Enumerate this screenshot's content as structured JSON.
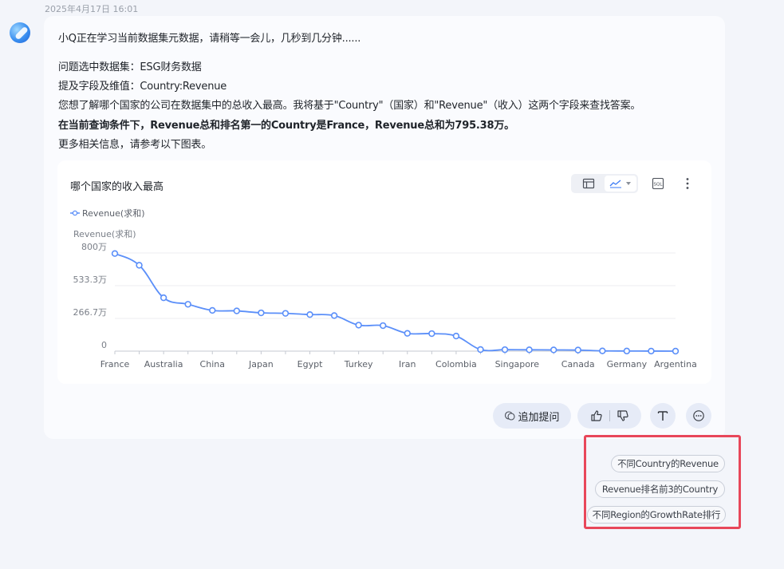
{
  "timestamp": "2025年4月17日 16:01",
  "message": {
    "loading": "小Q正在学习当前数据集元数据，请稍等一会儿，几秒到几分钟......",
    "dataset": "问题选中数据集：ESG财务数据",
    "fields": "提及字段及维值：Country:Revenue",
    "explain": "您想了解哪个国家的公司在数据集中的总收入最高。我将基于\"Country\"（国家）和\"Revenue\"（收入）这两个字段来查找答案。",
    "answer": "在当前查询条件下，Revenue总和排名第一的Country是France，Revenue总和为795.38万。",
    "more": "更多相关信息，请参考以下图表。"
  },
  "chart_card": {
    "title": "哪个国家的收入最高",
    "icons": {
      "table": "table-icon",
      "line": "line-chart-icon",
      "dropdown": "chevron-down-icon",
      "sql": "sql-icon",
      "more": "more-vertical-icon"
    },
    "sql_label": "SQL"
  },
  "chart_data": {
    "type": "line",
    "legend": [
      "Revenue(求和)"
    ],
    "legend_position": "top-left",
    "ylabel": "Revenue(求和)",
    "ylim": [
      0,
      8000000
    ],
    "yticks": [
      {
        "value": 0,
        "label": "0"
      },
      {
        "value": 2666667,
        "label": "266.7万"
      },
      {
        "value": 5333333,
        "label": "533.3万"
      },
      {
        "value": 8000000,
        "label": "800万"
      }
    ],
    "x_tick_labels": [
      "France",
      "Australia",
      "China",
      "Japan",
      "Egypt",
      "Turkey",
      "Iran",
      "Colombia",
      "Singapore",
      "Canada",
      "Germany",
      "Argentina"
    ],
    "grid": "horizontal",
    "color": "#5b8ff9",
    "series": [
      {
        "name": "Revenue(求和)",
        "values": [
          7953800,
          7000000,
          4350000,
          3820000,
          3320000,
          3280000,
          3120000,
          3080000,
          2980000,
          2900000,
          2120000,
          2080000,
          1450000,
          1430000,
          1230000,
          130000,
          120000,
          110000,
          100000,
          90000,
          20000,
          10000,
          5000,
          0
        ]
      }
    ]
  },
  "actions": {
    "followup_label": "追加提问",
    "icons": {
      "followup": "chat-bubble-icon",
      "like": "thumbs-up-icon",
      "dislike": "thumbs-down-icon",
      "text": "text-format-icon",
      "more": "more-horizontal-icon"
    }
  },
  "suggestions": [
    "不同Country的Revenue",
    "Revenue排名前3的Country",
    "不同Region的GrowthRate排行"
  ],
  "colors": {
    "accent": "#5b8ff9",
    "highlight_border": "#e8475a"
  }
}
